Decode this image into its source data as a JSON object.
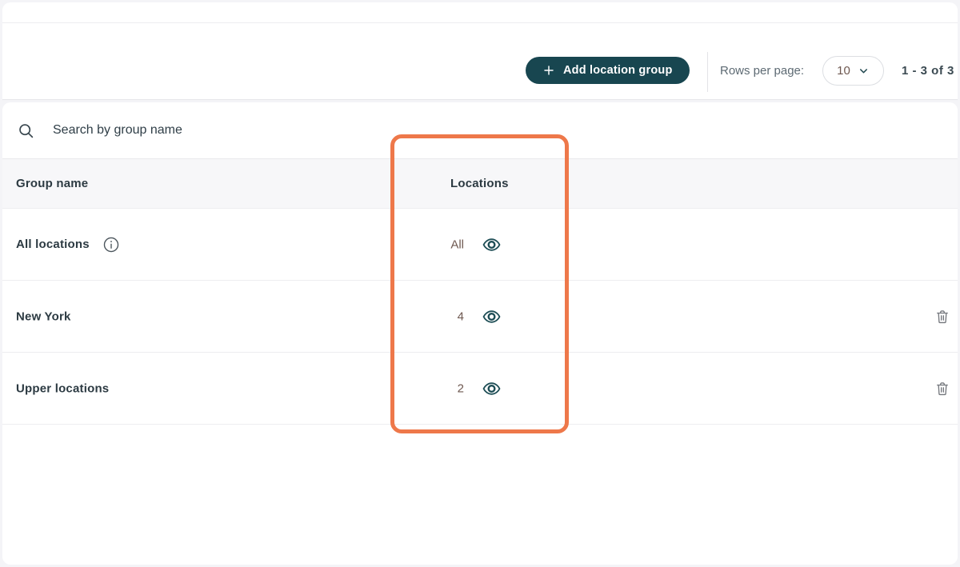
{
  "toolbar": {
    "add_button_label": "Add location group",
    "rows_per_page_label": "Rows per page:",
    "rows_per_page_value": "10",
    "range_text": "1 - 3  of  3"
  },
  "search": {
    "placeholder": "Search by group name"
  },
  "table": {
    "columns": {
      "group_name": "Group name",
      "locations": "Locations"
    },
    "rows": [
      {
        "name": "All locations",
        "count": "All",
        "has_info": true,
        "has_delete": false
      },
      {
        "name": "New York",
        "count": "4",
        "has_info": false,
        "has_delete": true
      },
      {
        "name": "Upper locations",
        "count": "2",
        "has_info": false,
        "has_delete": true
      }
    ]
  },
  "icons": {
    "add": "plus-icon",
    "rows_per_page": "chevron-down-icon",
    "search": "search-icon",
    "info": "info-circle-icon",
    "view": "eye-icon",
    "delete": "trash-icon"
  },
  "colors": {
    "accent_teal": "#184650",
    "highlight_orange": "#EE784A",
    "header_bg": "#F7F7F9",
    "count_text": "#6E5850"
  }
}
